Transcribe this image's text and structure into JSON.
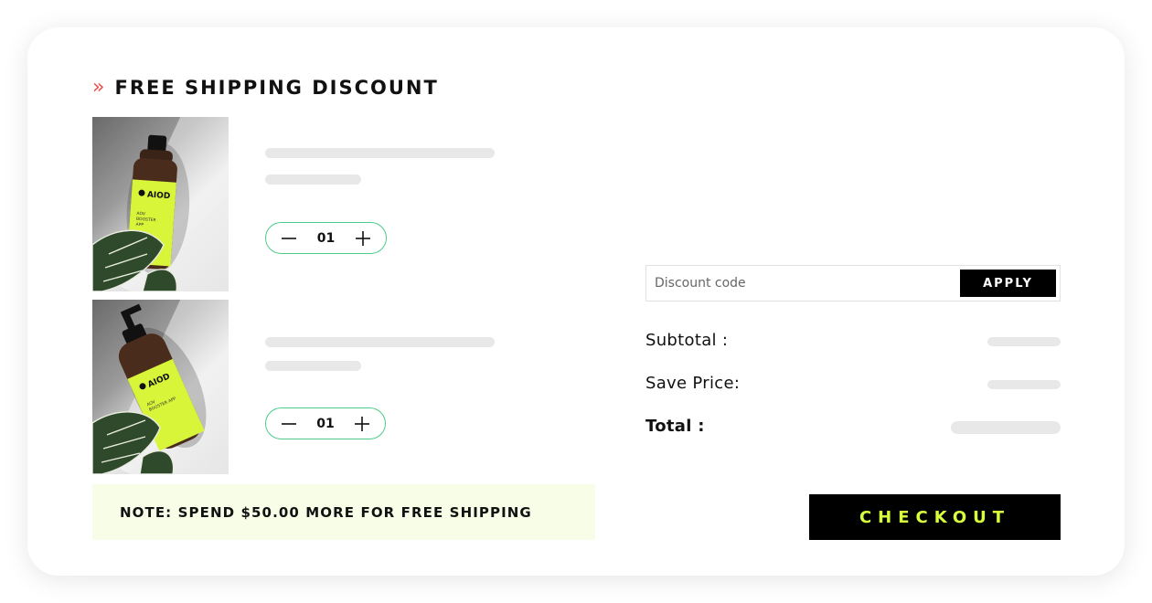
{
  "header": {
    "title": "FREE SHIPPING DISCOUNT",
    "chevron_icon": "double-chevron-right-icon",
    "chevron_color": "#e8504a"
  },
  "products": [
    {
      "name": "",
      "quantity": "01",
      "brand_label": "AIOD",
      "label_text": "AOV BOOSTER APP"
    },
    {
      "name": "",
      "quantity": "01",
      "brand_label": "AIOD",
      "label_text": "AOV BOOSTER APP"
    }
  ],
  "note": {
    "text": "NOTE: SPEND $50.00 MORE FOR FREE SHIPPING"
  },
  "discount": {
    "placeholder": "Discount code",
    "apply_label": "APPLY"
  },
  "summary": {
    "subtotal_label": "Subtotal :",
    "save_label": "Save Price:",
    "total_label": "Total :"
  },
  "checkout": {
    "label": "CHECKOUT"
  },
  "colors": {
    "accent_green": "#d7ff3c",
    "stepper_border": "#4ccb8a",
    "note_bg": "#f7fde6",
    "bottle_label": "#d8f53a"
  }
}
